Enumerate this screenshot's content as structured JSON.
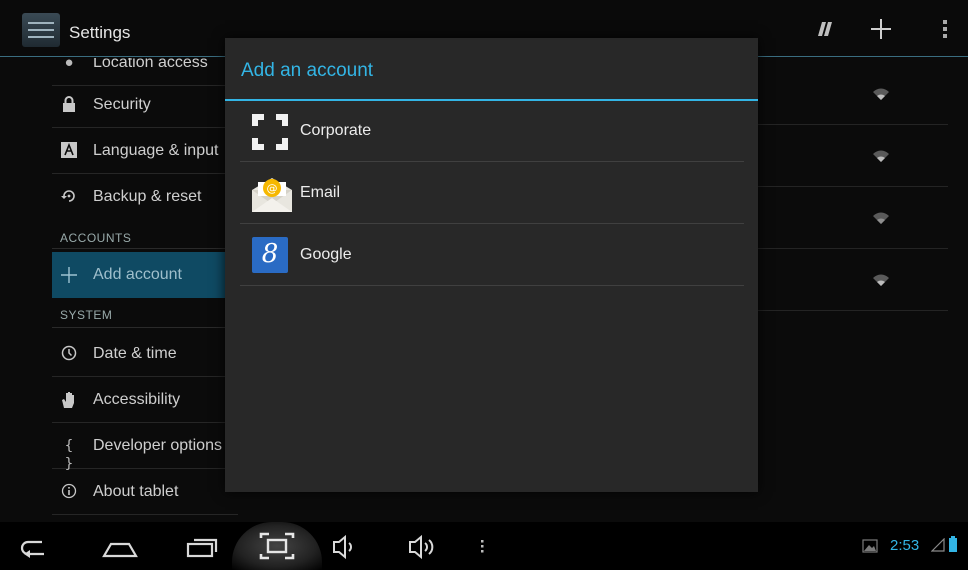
{
  "action_bar": {
    "title": "Settings",
    "icons": [
      "settings-app-icon",
      "sync-icon",
      "add-icon",
      "overflow-menu-icon"
    ]
  },
  "left_panel": {
    "items_top": [
      {
        "label": "Location access",
        "icon": "location-icon"
      },
      {
        "label": "Security",
        "icon": "lock-icon"
      },
      {
        "label": "Language & input",
        "icon": "keyboard-icon"
      },
      {
        "label": "Backup & reset",
        "icon": "backup-icon"
      }
    ],
    "accounts_header": "ACCOUNTS",
    "add_account": {
      "label": "Add account",
      "icon": "plus-icon"
    },
    "system_header": "SYSTEM",
    "items_system": [
      {
        "label": "Date & time",
        "icon": "clock-icon"
      },
      {
        "label": "Accessibility",
        "icon": "hand-icon"
      },
      {
        "label": "Developer options",
        "icon": "braces-icon",
        "glyph": "{ }"
      },
      {
        "label": "About tablet",
        "icon": "info-icon"
      }
    ]
  },
  "dialog": {
    "title": "Add an account",
    "accounts": [
      {
        "label": "Corporate",
        "icon": "corporate-icon"
      },
      {
        "label": "Email",
        "icon": "email-icon"
      },
      {
        "label": "Google",
        "icon": "google-icon",
        "glyph": "8"
      }
    ]
  },
  "nav_bar": {
    "buttons": [
      "back-icon",
      "home-icon",
      "recent-apps-icon",
      "screenshot-icon",
      "volume-down-icon",
      "volume-up-icon",
      "menu-icon"
    ],
    "time": "2:53"
  },
  "colors": {
    "accent": "#33b5e5",
    "selected_item": "#0f4a63",
    "dialog_bg": "#282828",
    "background": "#0b0b0b"
  }
}
